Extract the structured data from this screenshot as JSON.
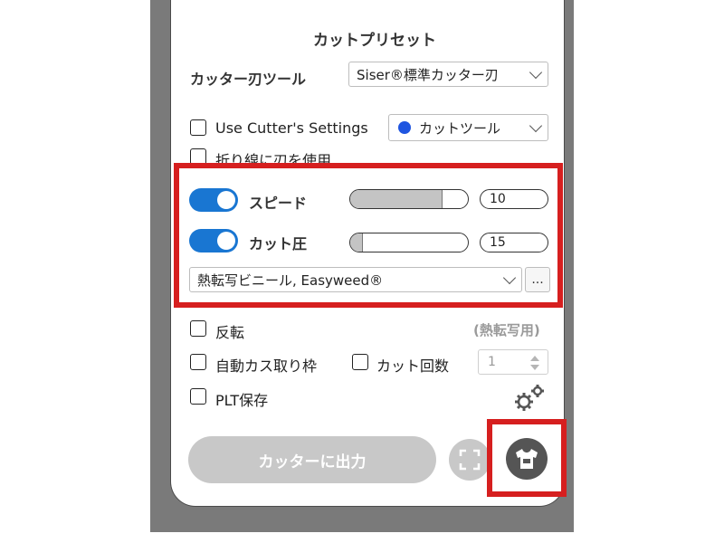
{
  "panel_title": "カットプリセット",
  "cutter_tool": {
    "label": "カッター刃ツール",
    "value": "Siser®標準カッター刃"
  },
  "use_cutter_settings": {
    "label": "Use Cutter's Settings",
    "checked": false,
    "tool_select": "カットツール",
    "tool_color": "#1f55e0"
  },
  "fold_line_label": "折り線に刃を使用",
  "speed": {
    "label": "スピード",
    "enabled": true,
    "fraction": 0.78,
    "value": "10"
  },
  "pressure": {
    "label": "カット圧",
    "enabled": true,
    "fraction": 0.1,
    "value": "15"
  },
  "material": {
    "value": "熱転写ビニール, Easyweed®",
    "more": "..."
  },
  "reverse": {
    "label": "反転",
    "note": "(熱転写用)",
    "checked": false
  },
  "auto_frame": {
    "label": "自動カス取り枠",
    "checked": false
  },
  "cut_count": {
    "label": "カット回数",
    "checked": false,
    "value": "1"
  },
  "plt_save": {
    "label": "PLT保存",
    "checked": false
  },
  "output_button": "カッターに出力",
  "accent_color": "#1976d2",
  "highlight_color": "#d61f1f"
}
